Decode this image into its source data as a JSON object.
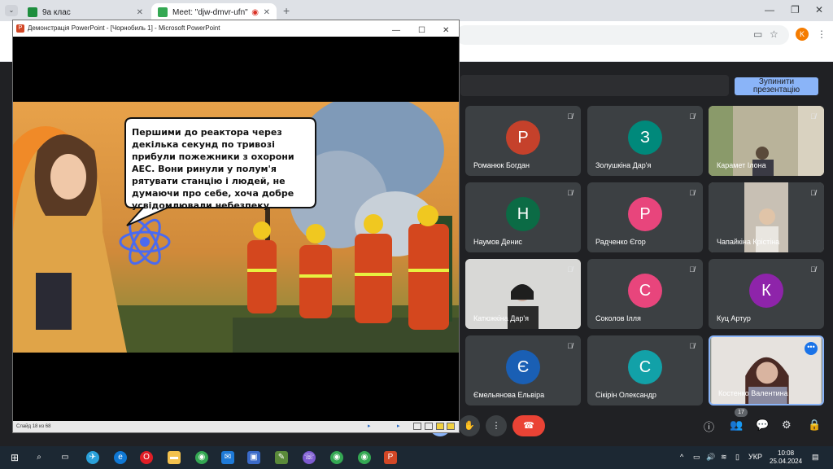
{
  "browser": {
    "tabs": [
      {
        "label": "9а клас",
        "active": false
      },
      {
        "label": "Meet: \"djw-dmvr-ufn\"",
        "active": true
      }
    ],
    "profile_initial": "K"
  },
  "meet": {
    "stop_presentation_label": "Зупинити презентацію",
    "participants": [
      {
        "name": "Романюк Богдан",
        "initial": "Р",
        "color": "#c5412b"
      },
      {
        "name": "Золушкіна Дар'я",
        "initial": "З",
        "color": "#00897b"
      },
      {
        "name": "Карамет Ілона",
        "initial": "",
        "color": ""
      },
      {
        "name": "Наумов Денис",
        "initial": "Н",
        "color": "#0b6b45"
      },
      {
        "name": "Радченко Єгор",
        "initial": "Р",
        "color": "#e8457c"
      },
      {
        "name": "Чапайкіна Крістіна",
        "initial": "",
        "color": ""
      },
      {
        "name": "Катюжкіна Дар'я",
        "initial": "",
        "color": ""
      },
      {
        "name": "Соколов Ілля",
        "initial": "С",
        "color": "#e8457c"
      },
      {
        "name": "Куц Артур",
        "initial": "К",
        "color": "#8e24aa"
      },
      {
        "name": "Ємельянова Ельвіра",
        "initial": "Є",
        "color": "#1a5fb4"
      },
      {
        "name": "Сікірін Олександр",
        "initial": "С",
        "color": "#12a1a8"
      },
      {
        "name": "Костенко Валентина",
        "initial": "",
        "color": ""
      }
    ],
    "participant_count": "17"
  },
  "ppt": {
    "window_title": "Демонстрація PowerPoint - [Чорнобиль 1] - Microsoft PowerPoint",
    "slide_text": "Першими до реактора через декілька секунд по тривозі прибули пожежники з охорони АЕС. Вони ринули у полум'я рятувати станцію і людей, не думаючи про себе, хоча добре усвідомлювали небезпеку.",
    "status": "Слайд 18 из 68"
  },
  "taskbar": {
    "lang": "УКР",
    "time": "10:08",
    "date": "25.04.2024"
  }
}
